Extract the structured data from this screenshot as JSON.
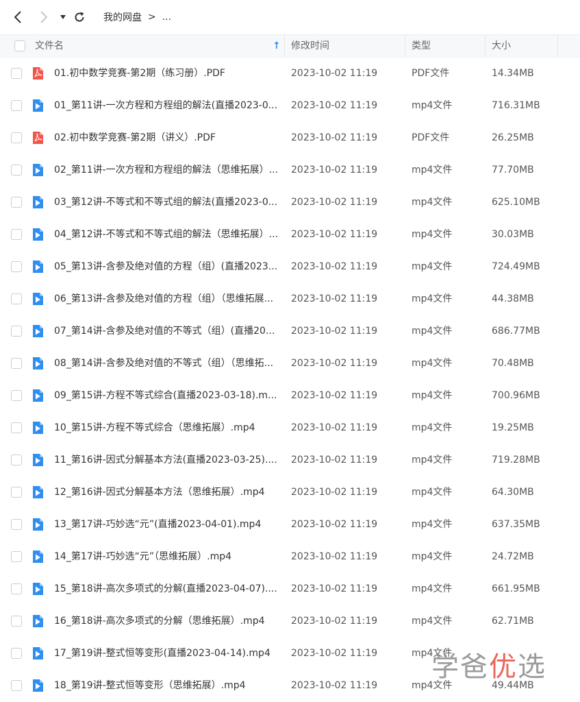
{
  "toolbar": {
    "breadcrumb_root": "我的网盘",
    "breadcrumb_sep": ">",
    "breadcrumb_more": "..."
  },
  "header": {
    "name": "文件名",
    "sort_arrow": "↑",
    "modified": "修改时间",
    "type": "类型",
    "size": "大小"
  },
  "colors": {
    "pdf": "#f0564b",
    "video": "#2f8ff0",
    "watermark_gray": "#8a8a8a",
    "watermark_red": "#e94b3c"
  },
  "files": [
    {
      "icon": "pdf",
      "name": "01.初中数学竞赛-第2期（练习册）.PDF",
      "date": "2023-10-02 11:19",
      "type": "PDF文件",
      "size": "14.34MB"
    },
    {
      "icon": "video",
      "name": "01_第11讲-一次方程和方程组的解法(直播2023-0...",
      "date": "2023-10-02 11:19",
      "type": "mp4文件",
      "size": "716.31MB"
    },
    {
      "icon": "pdf",
      "name": "02.初中数学竞赛-第2期（讲义）.PDF",
      "date": "2023-10-02 11:19",
      "type": "PDF文件",
      "size": "26.25MB"
    },
    {
      "icon": "video",
      "name": "02_第11讲-一次方程和方程组的解法（思维拓展）...",
      "date": "2023-10-02 11:19",
      "type": "mp4文件",
      "size": "77.70MB"
    },
    {
      "icon": "video",
      "name": "03_第12讲-不等式和不等式组的解法(直播2023-0...",
      "date": "2023-10-02 11:19",
      "type": "mp4文件",
      "size": "625.10MB"
    },
    {
      "icon": "video",
      "name": "04_第12讲-不等式和不等式组的解法（思维拓展）...",
      "date": "2023-10-02 11:19",
      "type": "mp4文件",
      "size": "30.03MB"
    },
    {
      "icon": "video",
      "name": "05_第13讲-含参及绝对值的方程（组）(直播2023...",
      "date": "2023-10-02 11:19",
      "type": "mp4文件",
      "size": "724.49MB"
    },
    {
      "icon": "video",
      "name": "06_第13讲-含参及绝对值的方程（组）（思维拓展...",
      "date": "2023-10-02 11:19",
      "type": "mp4文件",
      "size": "44.38MB"
    },
    {
      "icon": "video",
      "name": "07_第14讲-含参及绝对值的不等式（组）(直播20...",
      "date": "2023-10-02 11:19",
      "type": "mp4文件",
      "size": "686.77MB"
    },
    {
      "icon": "video",
      "name": "08_第14讲-含参及绝对值的不等式（组）（思维拓...",
      "date": "2023-10-02 11:19",
      "type": "mp4文件",
      "size": "70.48MB"
    },
    {
      "icon": "video",
      "name": "09_第15讲-方程不等式综合(直播2023-03-18).m...",
      "date": "2023-10-02 11:19",
      "type": "mp4文件",
      "size": "700.96MB"
    },
    {
      "icon": "video",
      "name": "10_第15讲-方程不等式综合（思维拓展）.mp4",
      "date": "2023-10-02 11:19",
      "type": "mp4文件",
      "size": "19.25MB"
    },
    {
      "icon": "video",
      "name": "11_第16讲-因式分解基本方法(直播2023-03-25)....",
      "date": "2023-10-02 11:19",
      "type": "mp4文件",
      "size": "719.28MB"
    },
    {
      "icon": "video",
      "name": "12_第16讲-因式分解基本方法（思维拓展）.mp4",
      "date": "2023-10-02 11:19",
      "type": "mp4文件",
      "size": "64.30MB"
    },
    {
      "icon": "video",
      "name": "13_第17讲-巧妙选“元”(直播2023-04-01).mp4",
      "date": "2023-10-02 11:19",
      "type": "mp4文件",
      "size": "637.35MB"
    },
    {
      "icon": "video",
      "name": "14_第17讲-巧妙选“元”（思维拓展）.mp4",
      "date": "2023-10-02 11:19",
      "type": "mp4文件",
      "size": "24.72MB"
    },
    {
      "icon": "video",
      "name": "15_第18讲-高次多项式的分解(直播2023-04-07)....",
      "date": "2023-10-02 11:19",
      "type": "mp4文件",
      "size": "661.95MB"
    },
    {
      "icon": "video",
      "name": "16_第18讲-高次多项式的分解（思维拓展）.mp4",
      "date": "2023-10-02 11:19",
      "type": "mp4文件",
      "size": "62.71MB"
    },
    {
      "icon": "video",
      "name": "17_第19讲-整式恒等变形(直播2023-04-14).mp4",
      "date": "2023-10-02 11:19",
      "type": "mp4文件",
      "size": ""
    },
    {
      "icon": "video",
      "name": "18_第19讲-整式恒等变形（思维拓展）.mp4",
      "date": "2023-10-02 11:19",
      "type": "mp4文件",
      "size": "49.44MB"
    }
  ],
  "watermark": {
    "part1": "学爸",
    "part2": "优",
    "part3": "选"
  }
}
